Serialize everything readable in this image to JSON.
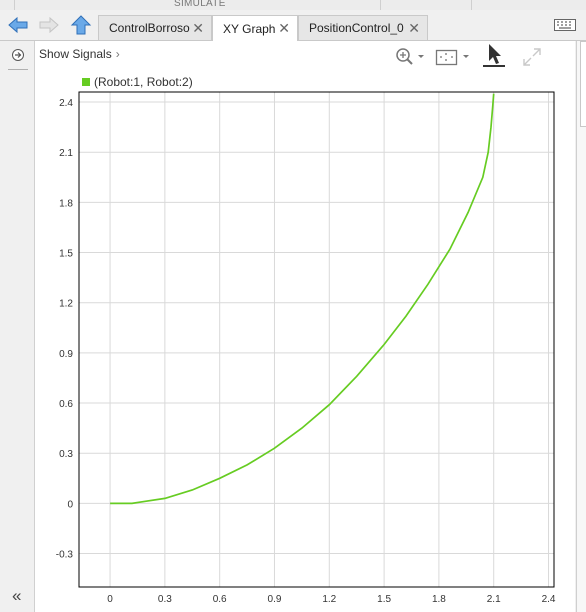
{
  "header": {
    "section_label": "SIMULATE"
  },
  "tabs": [
    {
      "label": "ControlBorroso",
      "active": false
    },
    {
      "label": "XY Graph",
      "active": true
    },
    {
      "label": "PositionControl_0",
      "active": false
    }
  ],
  "toolbar": {
    "show_signals_label": "Show Signals",
    "chevron": "›"
  },
  "icons": {
    "back": "arrow-left-icon",
    "forward": "arrow-right-icon",
    "up": "arrow-up-icon",
    "keyboard": "keyboard-icon",
    "zoom": "zoom-in-icon",
    "fit": "fit-to-view-icon",
    "cursor": "cursor-icon",
    "expand": "expand-icon",
    "collapse": "collapse-left-icon"
  },
  "colors": {
    "series": "#66cc22",
    "grid": "#d9d9d9",
    "axes": "#000000"
  },
  "chart_data": {
    "type": "line",
    "legend_entries": [
      "(Robot:1, Robot:2)"
    ],
    "series": [
      {
        "name": "(Robot:1, Robot:2)",
        "points": [
          [
            0.0,
            0.0
          ],
          [
            0.12,
            0.0
          ],
          [
            0.18,
            0.01
          ],
          [
            0.3,
            0.03
          ],
          [
            0.45,
            0.08
          ],
          [
            0.6,
            0.15
          ],
          [
            0.75,
            0.23
          ],
          [
            0.9,
            0.33
          ],
          [
            1.05,
            0.45
          ],
          [
            1.2,
            0.59
          ],
          [
            1.35,
            0.76
          ],
          [
            1.5,
            0.95
          ],
          [
            1.62,
            1.12
          ],
          [
            1.74,
            1.31
          ],
          [
            1.86,
            1.52
          ],
          [
            1.96,
            1.74
          ],
          [
            2.04,
            1.95
          ],
          [
            2.07,
            2.1
          ],
          [
            2.085,
            2.25
          ],
          [
            2.095,
            2.38
          ],
          [
            2.1,
            2.45
          ]
        ]
      }
    ],
    "xlim": [
      -0.17,
      2.43
    ],
    "ylim": [
      -0.5,
      2.46
    ],
    "xticks": [
      "0",
      "0.3",
      "0.6",
      "0.9",
      "1.2",
      "1.5",
      "1.8",
      "2.1",
      "2.4"
    ],
    "xtick_values": [
      0,
      0.3,
      0.6,
      0.9,
      1.2,
      1.5,
      1.8,
      2.1,
      2.4
    ],
    "yticks": [
      "-0.3",
      "0",
      "0.3",
      "0.6",
      "0.9",
      "1.2",
      "1.5",
      "1.8",
      "2.1",
      "2.4"
    ],
    "ytick_values": [
      -0.3,
      0,
      0.3,
      0.6,
      0.9,
      1.2,
      1.5,
      1.8,
      2.1,
      2.4
    ],
    "grid": true
  }
}
